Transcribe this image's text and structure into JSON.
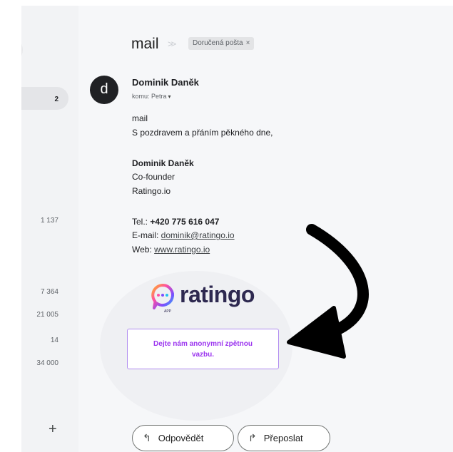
{
  "sidebar": {
    "counts": [
      {
        "value": "2",
        "selected": true
      },
      {
        "value": "1 137"
      },
      {
        "value": "7 364"
      },
      {
        "value": "21 005"
      },
      {
        "value": "14"
      },
      {
        "value": "34 000"
      }
    ],
    "add_icon": "plus-icon",
    "add_label": "+"
  },
  "header": {
    "subject": "mail",
    "label_chip": "Doručená pošta",
    "label_chip_close": "×"
  },
  "message": {
    "avatar_letter": "d",
    "sender_name": "Dominik Daněk",
    "recipient": "komu: Petra",
    "recipient_caret": "▾",
    "body": {
      "line1": "mail",
      "line2": "S pozdravem a přáním pěkného dne,"
    },
    "signature": {
      "name": "Dominik Daněk",
      "role": "Co-founder",
      "company": "Ratingo.io",
      "phone_label": "Tel.: ",
      "phone": "+420 775 616 047",
      "email_label": "E-mail: ",
      "email": "dominik@ratingo.io",
      "web_label": "Web: ",
      "web": "www.ratingo.io"
    },
    "logo": {
      "text": "ratingo",
      "sub": "APP",
      "brand_dark": "#2e2950",
      "gradient": [
        "#ff4fa3",
        "#ffb21f",
        "#25c1f0",
        "#7b4dff"
      ]
    },
    "feedback_button": "Dejte nám anonymní zpětnou vazbu.",
    "feedback_color": "#9b34ef"
  },
  "actions": {
    "reply_label": "Odpovědět",
    "reply_icon": "reply-arrow-icon",
    "reply_glyph": "↰",
    "forward_label": "Přeposlat",
    "forward_icon": "forward-arrow-icon",
    "forward_glyph": "↱"
  },
  "overlay": {
    "annotation": "curved-arrow-pointing-to-feedback-button",
    "color": "#000000"
  }
}
